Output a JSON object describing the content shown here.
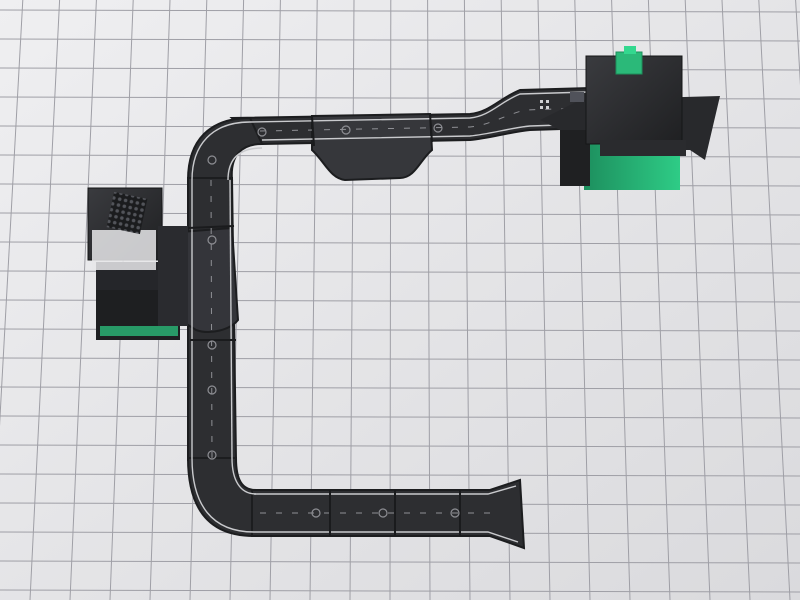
{
  "scene": {
    "background": "#e6e6e8",
    "grid_color": "#9d9da3",
    "grid_bg": "#dedee2",
    "road_color": "#2d2e31",
    "road_edge_color": "#1f2022",
    "lane_marking_color": "#c9cacd",
    "accent_color": "#2bb979",
    "accent_dark": "#1e8f5b"
  },
  "objects": {
    "road_pieces": [
      "straight",
      "curve",
      "curve",
      "straight",
      "bridge",
      "ramp",
      "ramp",
      "ramp"
    ],
    "buildings": [
      "left-station-building",
      "right-station-building"
    ],
    "road_counter_icons": 9
  }
}
